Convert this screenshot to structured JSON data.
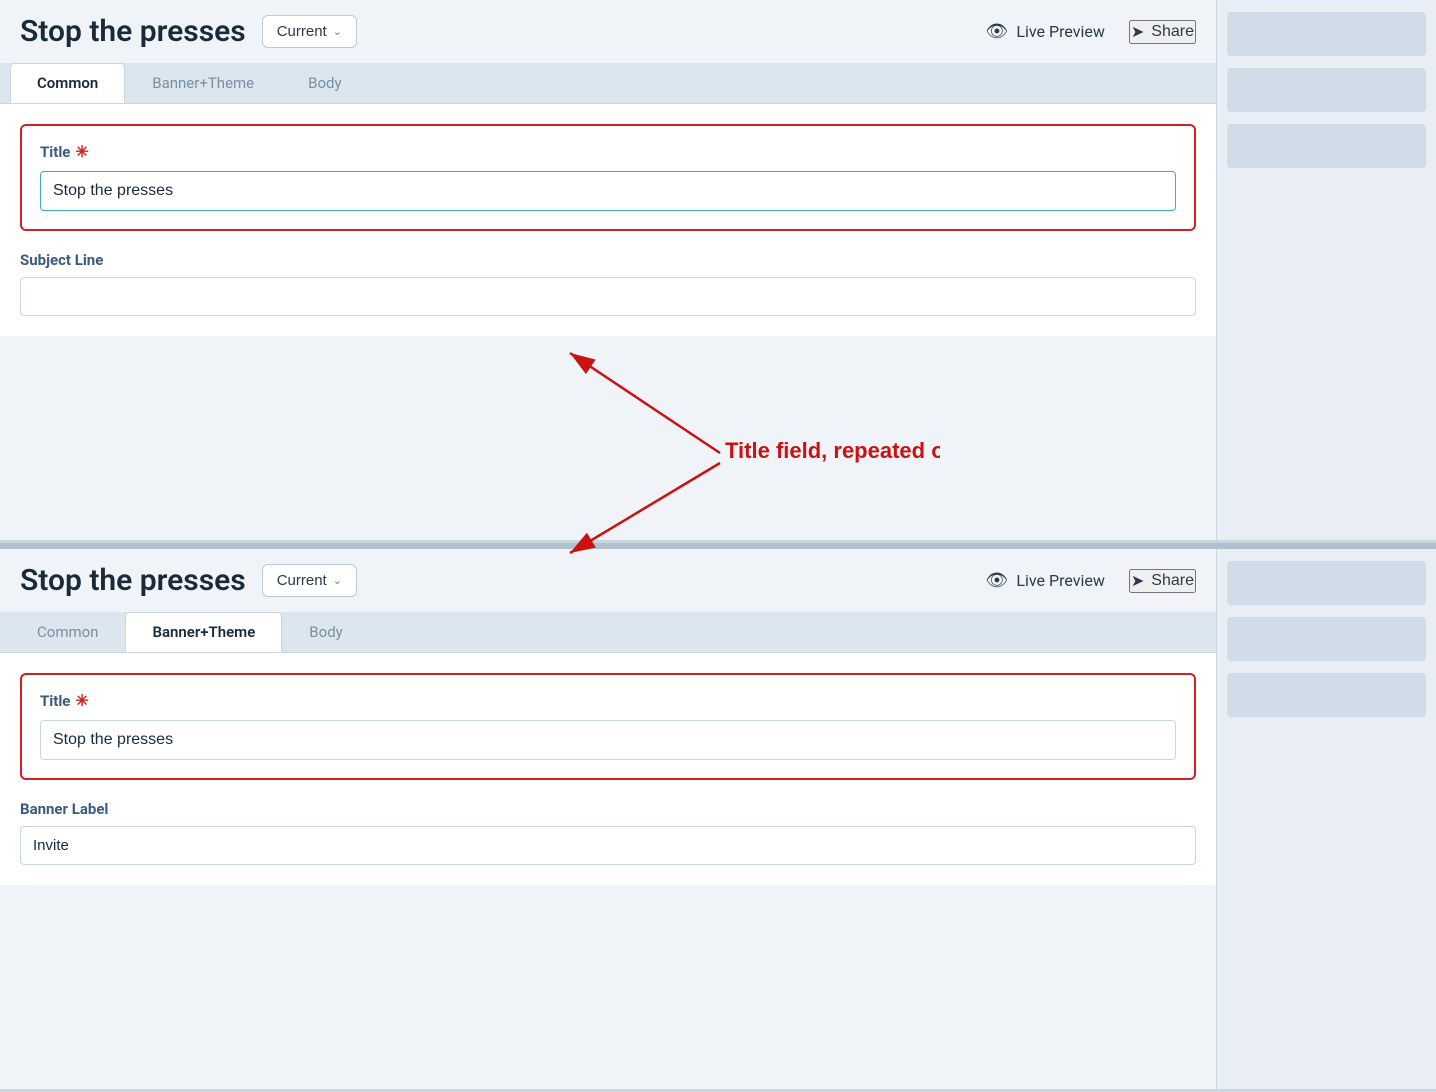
{
  "header": {
    "title": "Stop the presses",
    "current_label": "Current",
    "live_preview_label": "Live Preview",
    "share_label": "Share"
  },
  "tabs": {
    "common": "Common",
    "banner_theme": "Banner+Theme",
    "body": "Body"
  },
  "panel1": {
    "active_tab": "Common",
    "title_label": "Title",
    "title_value": "Stop the presses",
    "subject_line_label": "Subject Line",
    "subject_line_value": ""
  },
  "panel2": {
    "active_tab": "Banner+Theme",
    "title_label": "Title",
    "title_value": "Stop the presses",
    "banner_label_label": "Banner Label",
    "banner_label_value": "Invite"
  },
  "annotation": {
    "text": "Title field, repeated on each tab"
  },
  "sidebar1": {
    "items": [
      "",
      "",
      ""
    ]
  },
  "sidebar2": {
    "items": [
      "",
      "",
      ""
    ]
  }
}
